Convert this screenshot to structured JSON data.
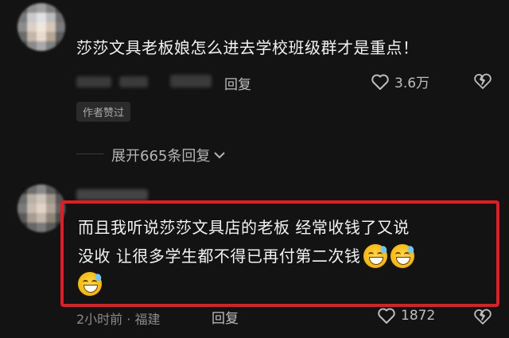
{
  "comment1": {
    "text": "莎莎文具老板娘怎么进去学校班级群才是重点！",
    "reply_label": "回复",
    "like_count": "3.6万",
    "author_liked_badge": "作者赞过",
    "expand_label": "展开665条回复"
  },
  "comment2": {
    "text_line1": "而且我听说莎莎文具店的老板 经常收钱了又说",
    "text_line2": "没收 让很多学生都不得已再付第二次钱",
    "meta": "2小时前 · 福建",
    "reply_label": "回复",
    "like_count": "1872"
  },
  "colors": {
    "background": "#131313",
    "highlight": "#e31b23",
    "text": "#f2f2f2",
    "muted": "#8a8a8a"
  },
  "icons": [
    "heart-outline-icon",
    "broken-heart-icon",
    "chevron-down-icon",
    "grinning-sweat-emoji"
  ]
}
